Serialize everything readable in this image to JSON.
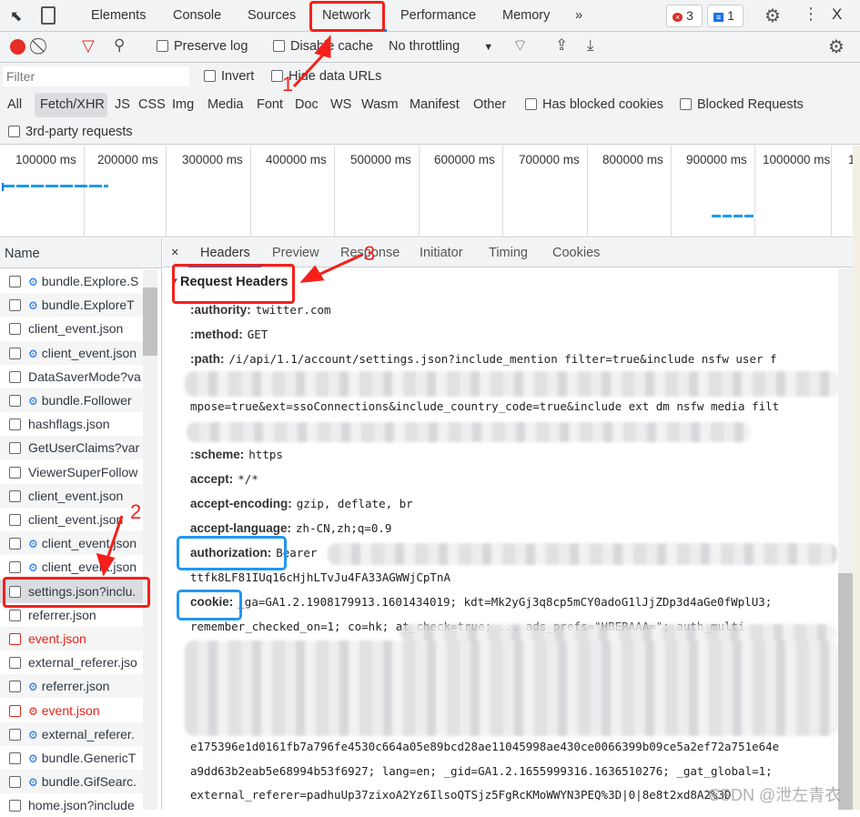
{
  "toolbar": {
    "tabs": [
      "Elements",
      "Console",
      "Sources",
      "Network",
      "Performance",
      "Memory"
    ],
    "more": "»",
    "errors": "3",
    "messages": "1",
    "close": "X",
    "active_tab": "Network"
  },
  "network_toolbar": {
    "preserve_log": "Preserve log",
    "disable_cache": "Disable cache",
    "throttling": "No throttling"
  },
  "filter": {
    "placeholder": "Filter",
    "invert": "Invert",
    "hide_data_urls": "Hide data URLs"
  },
  "types": [
    "All",
    "Fetch/XHR",
    "JS",
    "CSS",
    "Img",
    "Media",
    "Font",
    "Doc",
    "WS",
    "Wasm",
    "Manifest",
    "Other"
  ],
  "active_type": "Fetch/XHR",
  "checks": {
    "blocked_cookies": "Has blocked cookies",
    "blocked_requests": "Blocked Requests",
    "third_party": "3rd-party requests"
  },
  "timeline": {
    "ticks": [
      "100000 ms",
      "200000 ms",
      "300000 ms",
      "400000 ms",
      "500000 ms",
      "600000 ms",
      "700000 ms",
      "800000 ms",
      "900000 ms",
      "1000000 ms",
      "1"
    ]
  },
  "list": {
    "header": "Name",
    "rows": [
      {
        "name": "bundle.Explore.S",
        "gear": true
      },
      {
        "name": "bundle.ExploreT",
        "gear": true
      },
      {
        "name": "client_event.json",
        "gear": false
      },
      {
        "name": "client_event.json",
        "gear": true
      },
      {
        "name": "DataSaverMode?va",
        "gear": false
      },
      {
        "name": "bundle.Follower",
        "gear": true
      },
      {
        "name": "hashflags.json",
        "gear": false
      },
      {
        "name": "GetUserClaims?var",
        "gear": false
      },
      {
        "name": "ViewerSuperFollow",
        "gear": false
      },
      {
        "name": "client_event.json",
        "gear": false
      },
      {
        "name": "client_event.json",
        "gear": false
      },
      {
        "name": "client_event.json",
        "gear": true
      },
      {
        "name": "client_event.json",
        "gear": true
      },
      {
        "name": "settings.json?inclu.",
        "gear": false,
        "selected": true
      },
      {
        "name": "referrer.json",
        "gear": false
      },
      {
        "name": "event.json",
        "gear": false,
        "error": true
      },
      {
        "name": "external_referer.jso",
        "gear": false
      },
      {
        "name": "referrer.json",
        "gear": true
      },
      {
        "name": "event.json",
        "gear": true,
        "error": true
      },
      {
        "name": "external_referer.",
        "gear": true
      },
      {
        "name": "bundle.GenericT",
        "gear": true
      },
      {
        "name": "bundle.GifSearc.",
        "gear": true
      },
      {
        "name": "home.json?include",
        "gear": false
      }
    ]
  },
  "detail": {
    "close": "×",
    "tabs": [
      "Headers",
      "Preview",
      "Response",
      "Initiator",
      "Timing",
      "Cookies"
    ],
    "active_tab": "Headers",
    "section": "Request Headers",
    "lines": [
      {
        "key": ":authority:",
        "value": "twitter.com"
      },
      {
        "key": ":method:",
        "value": "GET"
      },
      {
        "key": ":path:",
        "value": "/i/api/1.1/account/settings.json?include_mention filter=true&include nsfw user f"
      },
      {
        "key": "",
        "value": "mpose=true&ext=ssoConnections&include_country_code=true&include ext dm nsfw media filt"
      },
      {
        "key": ":scheme:",
        "value": "https"
      },
      {
        "key": "accept:",
        "value": "*/*"
      },
      {
        "key": "accept-encoding:",
        "value": "gzip, deflate, br"
      },
      {
        "key": "accept-language:",
        "value": "zh-CN,zh;q=0.9"
      },
      {
        "key": "authorization:",
        "value": "Bearer"
      },
      {
        "key": "",
        "value": "ttfk8LF81IUq16cHjhLTvJu4FA33AGWWjCpTnA"
      },
      {
        "key": "cookie:",
        "value": "_ga=GA1.2.1908179913.1601434019; kdt=Mk2yGj3q8cp5mCY0adoG1lJjZDp3d4aGe0fWplU3;"
      },
      {
        "key": "",
        "value": "remember_checked_on=1; co=hk; at_check=true; ... ads_prefs=\"HBERAAA=\"; auth_multi"
      },
      {
        "key": "",
        "value": "e175396e1d0161fb7a796fe4530c664a05e89bcd28ae11045998ae430ce0066399b09ce5a2ef72a751e64e"
      },
      {
        "key": "",
        "value": "a9dd63b2eab5e68994b53f6927; lang=en; _gid=GA1.2.1655999316.1636510276; _gat_global=1;"
      },
      {
        "key": "",
        "value": "external_referer=padhuUp37zixoA2Yz6IlsoQTSjz5FgRcKMoWWYN3PEQ%3D|0|8e8t2xd8A2%3D"
      }
    ]
  },
  "annotations": {
    "n1": "1",
    "n2": "2",
    "n3": "3",
    "color_red": "#f5201b",
    "color_blue": "#2196f3"
  },
  "watermark": "CSDN @泄左青衣"
}
